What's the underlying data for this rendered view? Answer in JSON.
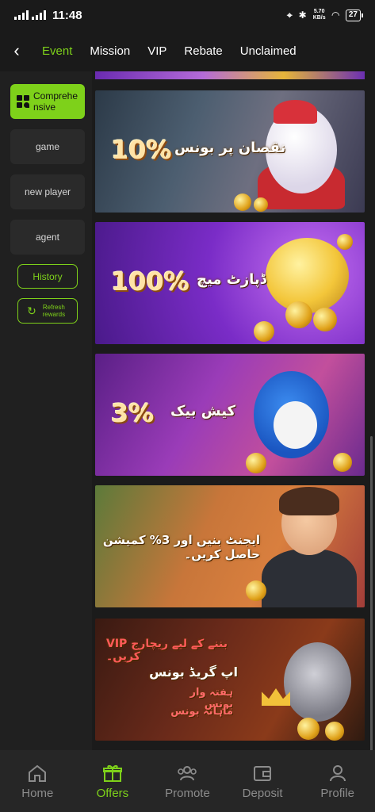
{
  "status_bar": {
    "time": "11:48",
    "network_speed_value": "5.70",
    "network_speed_unit": "KB/s",
    "battery": "27"
  },
  "top_nav": {
    "tabs": [
      {
        "label": "Event",
        "active": true
      },
      {
        "label": "Mission",
        "active": false
      },
      {
        "label": "VIP",
        "active": false
      },
      {
        "label": "Rebate",
        "active": false
      },
      {
        "label": "Unclaimed",
        "active": false
      }
    ]
  },
  "sidebar": {
    "active_item": "Comprehe nsive",
    "items": [
      "game",
      "new player",
      "agent"
    ],
    "history_label": "History",
    "refresh_label": "Refresh rewards"
  },
  "banners": [
    {
      "percent": "10%",
      "text": "نقصان پر بونس"
    },
    {
      "percent": "100%",
      "text": "ڈپازٹ میچ"
    },
    {
      "percent": "3%",
      "text": "کیش بیک"
    },
    {
      "percent": "",
      "text": "ایجنٹ بنیں اور 3% کمیشن حاصل کریں۔"
    },
    {
      "percent": "",
      "lines": [
        "VIP بننے کے لیے ریچارج کریں۔",
        "اپ گریڈ بونس",
        "ہفتہ وار بونس",
        "ماہانہ بونس"
      ]
    }
  ],
  "bottom_nav": {
    "items": [
      {
        "label": "Home",
        "icon": "home-icon",
        "active": false
      },
      {
        "label": "Offers",
        "icon": "gift-icon",
        "active": true
      },
      {
        "label": "Promote",
        "icon": "people-icon",
        "active": false
      },
      {
        "label": "Deposit",
        "icon": "wallet-icon",
        "active": false
      },
      {
        "label": "Profile",
        "icon": "person-icon",
        "active": false
      }
    ]
  },
  "colors": {
    "accent": "#7ed11a",
    "background": "#1b1b1b",
    "inactive": "#8c8c8c"
  }
}
